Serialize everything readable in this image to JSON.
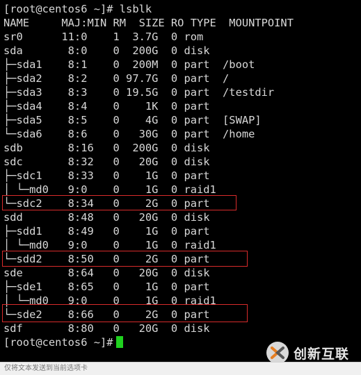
{
  "terminal": {
    "lines": [
      "[root@centos6 ~]# lsblk",
      "NAME     MAJ:MIN RM  SIZE RO TYPE  MOUNTPOINT",
      "sr0      11:0    1  3.7G  0 rom",
      "sda       8:0    0  200G  0 disk",
      "├─sda1    8:1    0  200M  0 part  /boot",
      "├─sda2    8:2    0 97.7G  0 part  /",
      "├─sda3    8:3    0 19.5G  0 part  /testdir",
      "├─sda4    8:4    0    1K  0 part",
      "├─sda5    8:5    0    4G  0 part  [SWAP]",
      "└─sda6    8:6    0   30G  0 part  /home",
      "sdb       8:16   0  200G  0 disk",
      "sdc       8:32   0   20G  0 disk",
      "├─sdc1    8:33   0    1G  0 part",
      "│ └─md0   9:0    0    1G  0 raid1",
      "└─sdc2    8:34   0    2G  0 part",
      "sdd       8:48   0   20G  0 disk",
      "├─sdd1    8:49   0    1G  0 part",
      "│ └─md0   9:0    0    1G  0 raid1",
      "└─sdd2    8:50   0    2G  0 part",
      "sde       8:64   0   20G  0 disk",
      "├─sde1    8:65   0    1G  0 part",
      "│ └─md0   9:0    0    1G  0 raid1",
      "└─sde2    8:66   0    2G  0 part",
      "sdf       8:80   0   20G  0 disk"
    ],
    "prompt": "[root@centos6 ~]#"
  },
  "statusbar": {
    "text": "仅将文本发送到当前选项卡"
  },
  "watermark": {
    "text": "创新互联"
  },
  "colors": {
    "background": "#000000",
    "text": "#d8d8d8",
    "cursor": "#1fd11f",
    "highlight_box": "#d92b2b"
  }
}
